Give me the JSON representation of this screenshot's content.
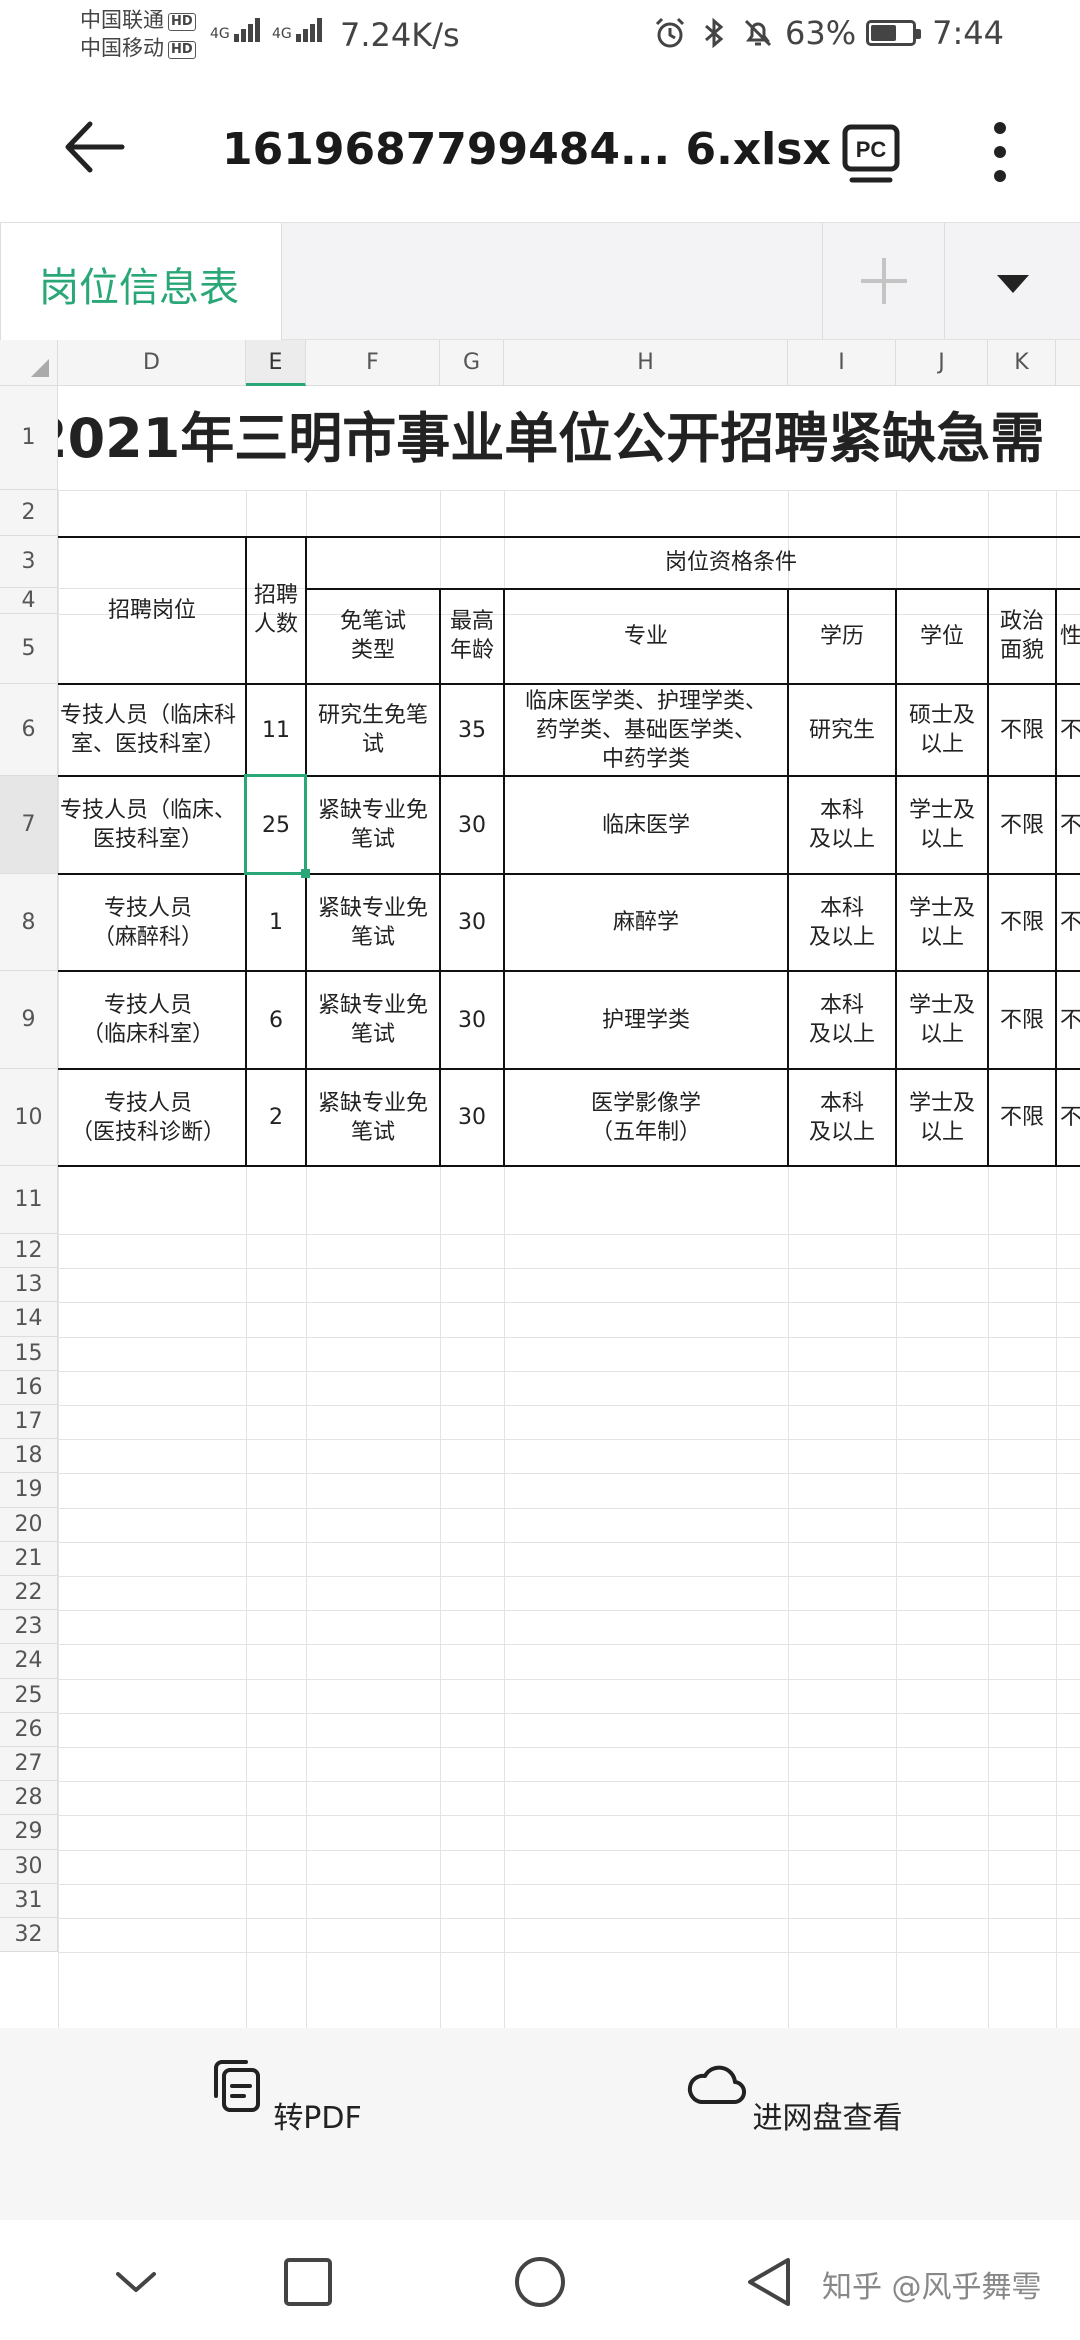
{
  "status_bar": {
    "carrier1": "中国联通",
    "carrier2": "中国移动",
    "hd": "HD",
    "net": "4G",
    "speed": "7.24K/s",
    "battery": "63%",
    "battery_level": 0.63,
    "time": "7:44"
  },
  "app_bar": {
    "file_name": "1619687799484... 6.xlsx",
    "pc_label": "PC"
  },
  "sheet": {
    "active_tab": "岗位信息表"
  },
  "columns": [
    "D",
    "E",
    "F",
    "G",
    "H",
    "I",
    "J",
    "K"
  ],
  "rows": [
    "1",
    "2",
    "3",
    "4",
    "5",
    "6",
    "7",
    "8",
    "9",
    "10",
    "11",
    "12",
    "13",
    "14",
    "15",
    "16",
    "17",
    "18",
    "19",
    "20",
    "21",
    "22",
    "23",
    "24",
    "25",
    "26",
    "27",
    "28",
    "29",
    "30",
    "31",
    "32"
  ],
  "table": {
    "title": "2021年三明市事业单位公开招聘紧缺急需",
    "group_header": "岗位资格条件",
    "headers": {
      "post": "招聘岗位",
      "count": "招聘\n人数",
      "exempt": "免笔试\n类型",
      "age": "最高\n年龄",
      "major": "专业",
      "edu": "学历",
      "degree": "学位",
      "politics": "政治\n面貌",
      "gender": "性"
    },
    "data": [
      {
        "post": "专技人员（临床科\n室、医技科室）",
        "count": "11",
        "exempt": "研究生免笔\n试",
        "age": "35",
        "major": "临床医学类、护理学类、\n药学类、基础医学类、\n中药学类",
        "edu": "研究生",
        "degree": "硕士及\n以上",
        "politics": "不限",
        "gender": "不"
      },
      {
        "post": "专技人员（临床、\n医技科室）",
        "count": "25",
        "exempt": "紧缺专业免\n笔试",
        "age": "30",
        "major": "临床医学",
        "edu": "本科\n及以上",
        "degree": "学士及\n以上",
        "politics": "不限",
        "gender": "不"
      },
      {
        "post": "专技人员\n（麻醉科）",
        "count": "1",
        "exempt": "紧缺专业免\n笔试",
        "age": "30",
        "major": "麻醉学",
        "edu": "本科\n及以上",
        "degree": "学士及\n以上",
        "politics": "不限",
        "gender": "不"
      },
      {
        "post": "专技人员\n（临床科室）",
        "count": "6",
        "exempt": "紧缺专业免\n笔试",
        "age": "30",
        "major": "护理学类",
        "edu": "本科\n及以上",
        "degree": "学士及\n以上",
        "politics": "不限",
        "gender": "不"
      },
      {
        "post": "专技人员\n（医技科诊断）",
        "count": "2",
        "exempt": "紧缺专业免\n笔试",
        "age": "30",
        "major": "医学影像学\n（五年制）",
        "edu": "本科\n及以上",
        "degree": "学士及\n以上",
        "politics": "不限",
        "gender": "不"
      }
    ]
  },
  "actions": {
    "to_pdf": "转PDF",
    "open_cloud": "进网盘查看"
  },
  "watermark": "知乎 @风乎舞雩"
}
